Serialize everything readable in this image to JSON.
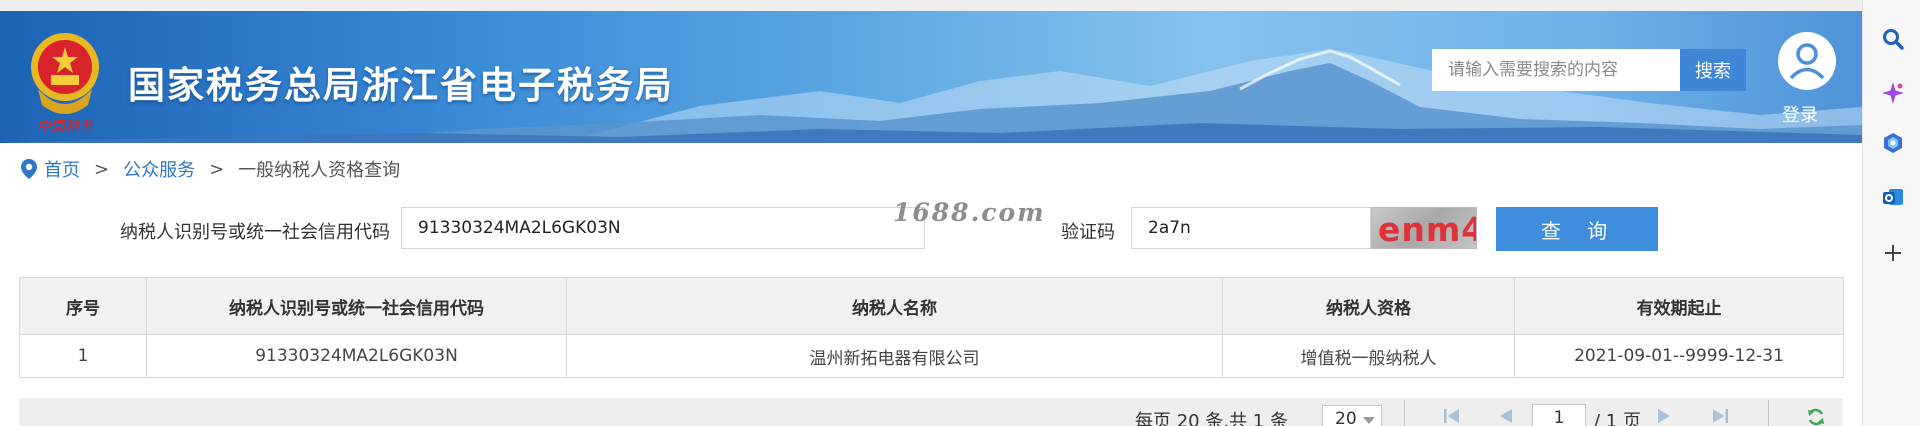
{
  "header": {
    "title": "国家税务总局浙江省电子税务局",
    "emblem_caption": "中国税务",
    "search": {
      "placeholder": "请输入需要搜索的内容",
      "button_label": "搜索"
    },
    "login_label": "登录"
  },
  "breadcrumb": {
    "items": [
      "首页",
      "公众服务",
      "一般纳税人资格查询"
    ],
    "separator": ">"
  },
  "form": {
    "tax_id_label": "纳税人识别号或统一社会信用代码",
    "tax_id_value": "91330324MA2L6GK03N",
    "watermark": "1688.com",
    "captcha_label": "验证码",
    "captcha_value": "2a7n",
    "captcha_image_text": "enm4",
    "query_button": "查 询"
  },
  "table": {
    "headers": [
      "序号",
      "纳税人识别号或统一社会信用代码",
      "纳税人名称",
      "纳税人资格",
      "有效期起止"
    ],
    "rows": [
      [
        "1",
        "91330324MA2L6GK03N",
        "温州新拓电器有限公司",
        "增值税一般纳税人",
        "2021-09-01--9999-12-31"
      ]
    ]
  },
  "pagination": {
    "summary": "每页 20 条,共 1 条",
    "page_size": "20",
    "current_page": "1",
    "total_pages": "/ 1 页"
  },
  "sidebar": {
    "icons": [
      "search-icon",
      "copilot-icon",
      "sparkle-app-icon",
      "outlook-icon",
      "add-icon"
    ]
  },
  "colors": {
    "header_blue": "#2a78c8",
    "link_blue": "#2c77c8",
    "button_blue": "#3f8ede",
    "captcha_red": "#e0303a"
  }
}
